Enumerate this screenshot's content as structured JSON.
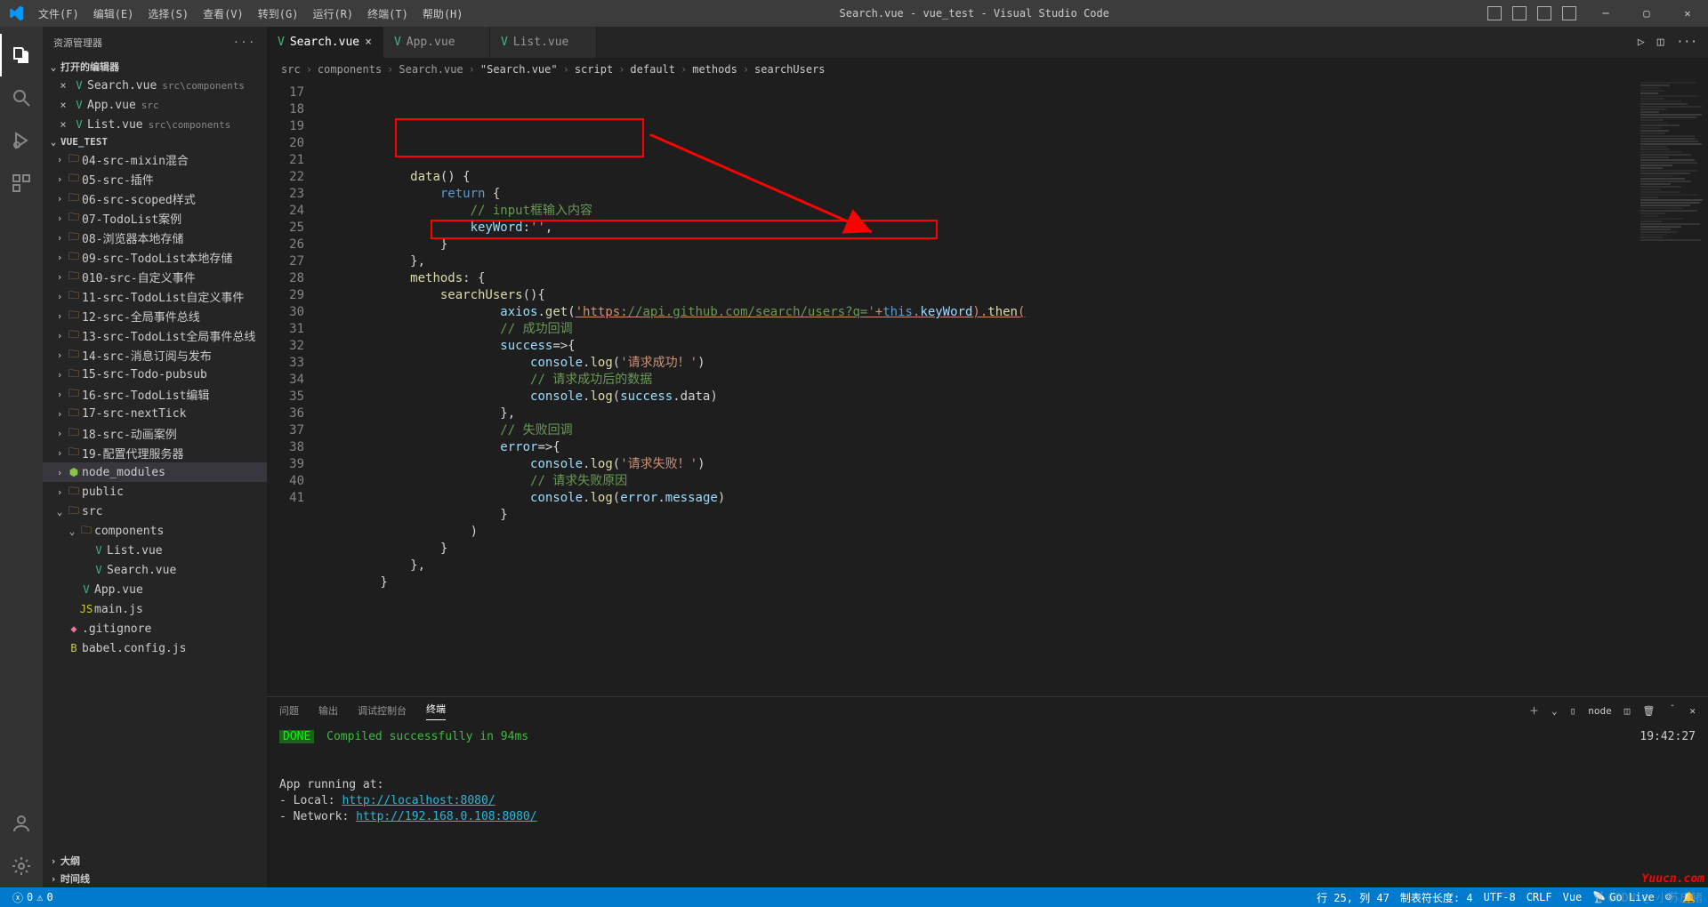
{
  "window": {
    "title": "Search.vue - vue_test - Visual Studio Code"
  },
  "menu": [
    "文件(F)",
    "编辑(E)",
    "选择(S)",
    "查看(V)",
    "转到(G)",
    "运行(R)",
    "终端(T)",
    "帮助(H)"
  ],
  "explorer": {
    "title": "资源管理器",
    "openEditors": {
      "label": "打开的编辑器",
      "items": [
        {
          "name": "Search.vue",
          "hint": "src\\components",
          "active": true
        },
        {
          "name": "App.vue",
          "hint": "src"
        },
        {
          "name": "List.vue",
          "hint": "src\\components"
        }
      ]
    },
    "project": "VUE_TEST",
    "outline": "大纲",
    "timeline": "时间线"
  },
  "tree": [
    {
      "depth": 0,
      "chev": "›",
      "icon": "folder",
      "label": "04-src-mixin混合"
    },
    {
      "depth": 0,
      "chev": "›",
      "icon": "folder",
      "label": "05-src-插件"
    },
    {
      "depth": 0,
      "chev": "›",
      "icon": "folder",
      "label": "06-src-scoped样式"
    },
    {
      "depth": 0,
      "chev": "›",
      "icon": "folder",
      "label": "07-TodoList案例"
    },
    {
      "depth": 0,
      "chev": "›",
      "icon": "folder",
      "label": "08-浏览器本地存储"
    },
    {
      "depth": 0,
      "chev": "›",
      "icon": "folder",
      "label": "09-src-TodoList本地存储"
    },
    {
      "depth": 0,
      "chev": "›",
      "icon": "folder",
      "label": "010-src-自定义事件"
    },
    {
      "depth": 0,
      "chev": "›",
      "icon": "folder",
      "label": "11-src-TodoList自定义事件"
    },
    {
      "depth": 0,
      "chev": "›",
      "icon": "folder",
      "label": "12-src-全局事件总线"
    },
    {
      "depth": 0,
      "chev": "›",
      "icon": "folder",
      "label": "13-src-TodoList全局事件总线"
    },
    {
      "depth": 0,
      "chev": "›",
      "icon": "folder",
      "label": "14-src-消息订阅与发布"
    },
    {
      "depth": 0,
      "chev": "›",
      "icon": "folder",
      "label": "15-src-Todo-pubsub"
    },
    {
      "depth": 0,
      "chev": "›",
      "icon": "folder",
      "label": "16-src-TodoList编辑"
    },
    {
      "depth": 0,
      "chev": "›",
      "icon": "folder",
      "label": "17-src-nextTick"
    },
    {
      "depth": 0,
      "chev": "›",
      "icon": "folder",
      "label": "18-src-动画案例"
    },
    {
      "depth": 0,
      "chev": "›",
      "icon": "folder",
      "label": "19-配置代理服务器"
    },
    {
      "depth": 0,
      "chev": "›",
      "icon": "node",
      "label": "node_modules",
      "selected": true
    },
    {
      "depth": 0,
      "chev": "›",
      "icon": "folder",
      "label": "public"
    },
    {
      "depth": 0,
      "chev": "⌄",
      "icon": "folder",
      "label": "src"
    },
    {
      "depth": 1,
      "chev": "⌄",
      "icon": "folder",
      "label": "components"
    },
    {
      "depth": 2,
      "chev": "",
      "icon": "vue",
      "label": "List.vue"
    },
    {
      "depth": 2,
      "chev": "",
      "icon": "vue",
      "label": "Search.vue"
    },
    {
      "depth": 1,
      "chev": "",
      "icon": "vue",
      "label": "App.vue"
    },
    {
      "depth": 1,
      "chev": "",
      "icon": "js",
      "label": "main.js"
    },
    {
      "depth": 0,
      "chev": "",
      "icon": "git",
      "label": ".gitignore"
    },
    {
      "depth": 0,
      "chev": "",
      "icon": "babel",
      "label": "babel.config.js"
    }
  ],
  "tabs": [
    {
      "label": "Search.vue",
      "active": true
    },
    {
      "label": "App.vue"
    },
    {
      "label": "List.vue"
    }
  ],
  "breadcrumb": [
    "src",
    "components",
    "Search.vue",
    "\"Search.vue\"",
    "script",
    "default",
    "methods",
    "searchUsers"
  ],
  "code": {
    "startLine": 17,
    "lines": [
      "            data() {",
      "                return {",
      "                    // input框输入内容",
      "                    keyWord:'',",
      "                }",
      "            },",
      "            methods: {",
      "                searchUsers(){",
      "                        axios.get('https://api.github.com/search/users?q='+this.keyWord).then(",
      "                        // 成功回调",
      "                        success=>{",
      "                            console.log('请求成功！')",
      "                            // 请求成功后的数据",
      "                            console.log(success.data)",
      "                        },",
      "                        // 失败回调",
      "                        error=>{",
      "                            console.log('请求失败！')",
      "                            // 请求失败原因",
      "                            console.log(error.message)",
      "                        }",
      "                    )",
      "                }",
      "            },",
      "        }"
    ]
  },
  "panel": {
    "tabs": [
      "问题",
      "输出",
      "调试控制台",
      "终端"
    ],
    "activeTab": 3,
    "terminalName": "node",
    "done": "DONE",
    "compiled": " Compiled successfully in 94ms",
    "time": "19:42:27",
    "running": "  App running at:",
    "localLabel": "  - Local:   ",
    "localUrl": "http://localhost:8080/",
    "networkLabel": "  - Network: ",
    "networkUrl": "http://192.168.0.108:8080/"
  },
  "status": {
    "errors": "0",
    "warnings": "0",
    "ln": "行 25, 列 47",
    "tab": "制表符长度: 4",
    "enc": "UTF-8",
    "eol": "CRLF",
    "lang": "Vue",
    "live": "Go Live",
    "bell": "",
    "feedback": ""
  },
  "watermark1": "Yuucn.com",
  "watermark2": "CSDN @ 小苏皮猪"
}
